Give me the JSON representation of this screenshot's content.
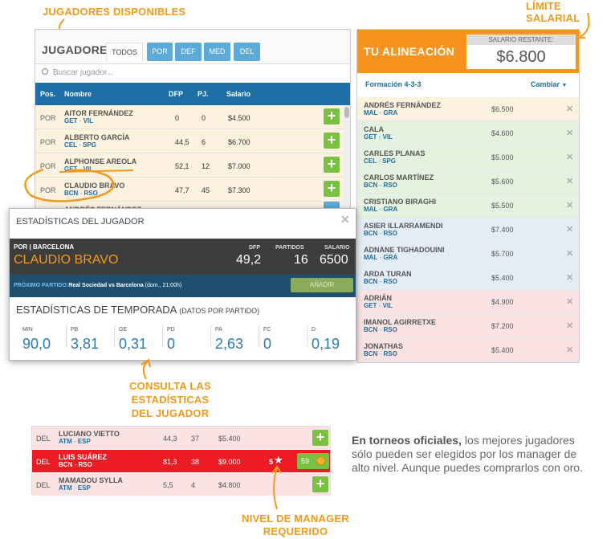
{
  "callouts": {
    "disponibles": "JUGADORES DISPONIBLES",
    "limite": "LÍMITE SALARIAL",
    "consulta_l1": "CONSULTA LAS ESTADÍSTICAS",
    "consulta_l2": "DEL JUGADOR",
    "nivel_l1": "NIVEL DE MANAGER",
    "nivel_l2": "REQUERIDO"
  },
  "players_panel": {
    "title": "JUGADORES",
    "tabs": [
      "TODOS",
      "POR",
      "DEF",
      "MED",
      "DEL"
    ],
    "search_placeholder": "Buscar jugador...",
    "columns": [
      "Pos.",
      "Nombre",
      "DFP",
      "PJ.",
      "Salario"
    ],
    "rows": [
      {
        "pos": "POR",
        "name": "AITOR FERNÁNDEZ",
        "team_a": "GET",
        "vs": " - ",
        "team_b": "VIL",
        "dfp": "0",
        "pj": "0",
        "salary": "$4.500",
        "bg": "#fdf1e0"
      },
      {
        "pos": "POR",
        "name": "ALBERTO GARCÍA",
        "team_a": "CEL",
        "vs": " - ",
        "team_b": "SPG",
        "dfp": "44,5",
        "pj": "6",
        "salary": "$6.700",
        "bg": "#fdf1e0"
      },
      {
        "pos": "POR",
        "name": "ALPHONSE AREOLA",
        "team_a": "GET",
        "vs": " - ",
        "team_b": "VIL",
        "dfp": "52,1",
        "pj": "12",
        "salary": "$7.000",
        "bg": "#fdf1e0"
      },
      {
        "pos": "POR",
        "name": "CLAUDIO BRAVO",
        "team_a": "BCN",
        "vs": " - ",
        "team_b": "RSO",
        "dfp": "47,7",
        "pj": "45",
        "salary": "$7.300",
        "bg": "#fdf1e0"
      },
      {
        "pos": "POR",
        "name": "ANDRÉS FERNÁNDEZ",
        "team_a": "",
        "vs": "",
        "team_b": "",
        "dfp": "",
        "pj": "",
        "salary": "",
        "bg": "#fdf1e0"
      }
    ]
  },
  "lineup": {
    "title": "TU ALINEACIÓN",
    "salary_label": "SALARIO RESTANTE:",
    "salary_value": "$6.800",
    "formation": "Formación 4-3-3",
    "change": "Cambiar",
    "rows": [
      {
        "name": "ANDRÉS FERNÁNDEZ",
        "team_a": "MAL",
        "vs": " - ",
        "team_b": "GRA",
        "salary": "$6.500",
        "bg": "#fdf1e0"
      },
      {
        "name": "CALA",
        "team_a": "GET",
        "vs": " - ",
        "team_b": "VIL",
        "salary": "$4.600",
        "bg": "#e6f2e0"
      },
      {
        "name": "CARLES PLANAS",
        "team_a": "CEL",
        "vs": " - ",
        "team_b": "SPG",
        "salary": "$5.000",
        "bg": "#e6f2e0"
      },
      {
        "name": "CARLOS MARTÍNEZ",
        "team_a": "BCN",
        "vs": " - ",
        "team_b": "RSO",
        "salary": "$5.600",
        "bg": "#e6f2e0"
      },
      {
        "name": "CRISTIANO BIRAGHI",
        "team_a": "MAL",
        "vs": " - ",
        "team_b": "GRA",
        "salary": "$5.500",
        "bg": "#e6f2e0"
      },
      {
        "name": "ASIER ILLARRAMENDI",
        "team_a": "BCN",
        "vs": " - ",
        "team_b": "RSO",
        "salary": "$7.400",
        "bg": "#e4edf6"
      },
      {
        "name": "ADNANE TIGHADOUINI",
        "team_a": "MAL",
        "vs": " - ",
        "team_b": "GRA",
        "salary": "$5.700",
        "bg": "#e4edf6"
      },
      {
        "name": "ARDA TURAN",
        "team_a": "BCN",
        "vs": " - ",
        "team_b": "RSO",
        "salary": "$5.400",
        "bg": "#e4edf6"
      },
      {
        "name": "ADRIÁN",
        "team_a": "GET",
        "vs": " - ",
        "team_b": "VIL",
        "salary": "$4.900",
        "bg": "#fbe3e3"
      },
      {
        "name": "IMANOL AGIRRETXE",
        "team_a": "BCN",
        "vs": " - ",
        "team_b": "RSO",
        "salary": "$7.200",
        "bg": "#fbe3e3"
      },
      {
        "name": "JONATHAS",
        "team_a": "BCN",
        "vs": " - ",
        "team_b": "RSO",
        "salary": "$5.400",
        "bg": "#fbe3e3"
      }
    ]
  },
  "stats_popup": {
    "title": "ESTADÍSTICAS DEL JUGADOR",
    "pos": "POR",
    "sep": " | ",
    "club": "BARCELONA",
    "player": "CLAUDIO BRAVO",
    "dfp_label": "DFP",
    "dfp": "49,2",
    "partidos_label": "PARTIDOS",
    "partidos": "16",
    "salario_label": "SALARIO",
    "salario": "6500",
    "next_label": "PRÓXIMO PARTIDO:",
    "next_match": "Real Sociedad vs Barcelona",
    "next_time": "(dom., 21:00h)",
    "add": "AÑADIR",
    "season_title": "ESTADÍSTICAS DE TEMPORADA",
    "season_sub": "(DATOS POR PARTIDO)",
    "stats": [
      {
        "label": "MIN",
        "value": "90,0"
      },
      {
        "label": "PB",
        "value": "3,81"
      },
      {
        "label": "GE",
        "value": "0,31"
      },
      {
        "label": "PD",
        "value": "0"
      },
      {
        "label": "PA",
        "value": "2,63"
      },
      {
        "label": "FC",
        "value": "0"
      },
      {
        "label": "D",
        "value": "0,19"
      }
    ]
  },
  "bottom_list": {
    "rows": [
      {
        "pos": "DEL",
        "name": "LUCIANO VIETTO",
        "team_a": "ATM",
        "vs": " - ",
        "team_b": "ESP",
        "dfp": "44,3",
        "pj": "37",
        "salary": "$5.400"
      },
      {
        "pos": "DEL",
        "name": "LUIS SUÁREZ",
        "team_a": "BCN",
        "vs": " - ",
        "team_b": "RSO",
        "dfp": "81,3",
        "pj": "38",
        "salary": "$9.000",
        "level": "5",
        "gold": "59"
      },
      {
        "pos": "DEL",
        "name": "MAMADOU SYLLA",
        "team_a": "ATM",
        "vs": " - ",
        "team_b": "ESP",
        "dfp": "5,5",
        "pj": "4",
        "salary": "$4.800"
      }
    ]
  },
  "info_text": {
    "bold": "En torneos oficiales,",
    "rest": " los mejores jugadores sólo pueden ser elegidos por los manager de alto nivel. Aunque puedes comprarlos con oro."
  },
  "colors": {
    "accent": "#f29a1b",
    "header_blue": "#1d6ea5",
    "tab_blue": "#5baad8",
    "green": "#7ac143",
    "red": "#ed1c24"
  }
}
